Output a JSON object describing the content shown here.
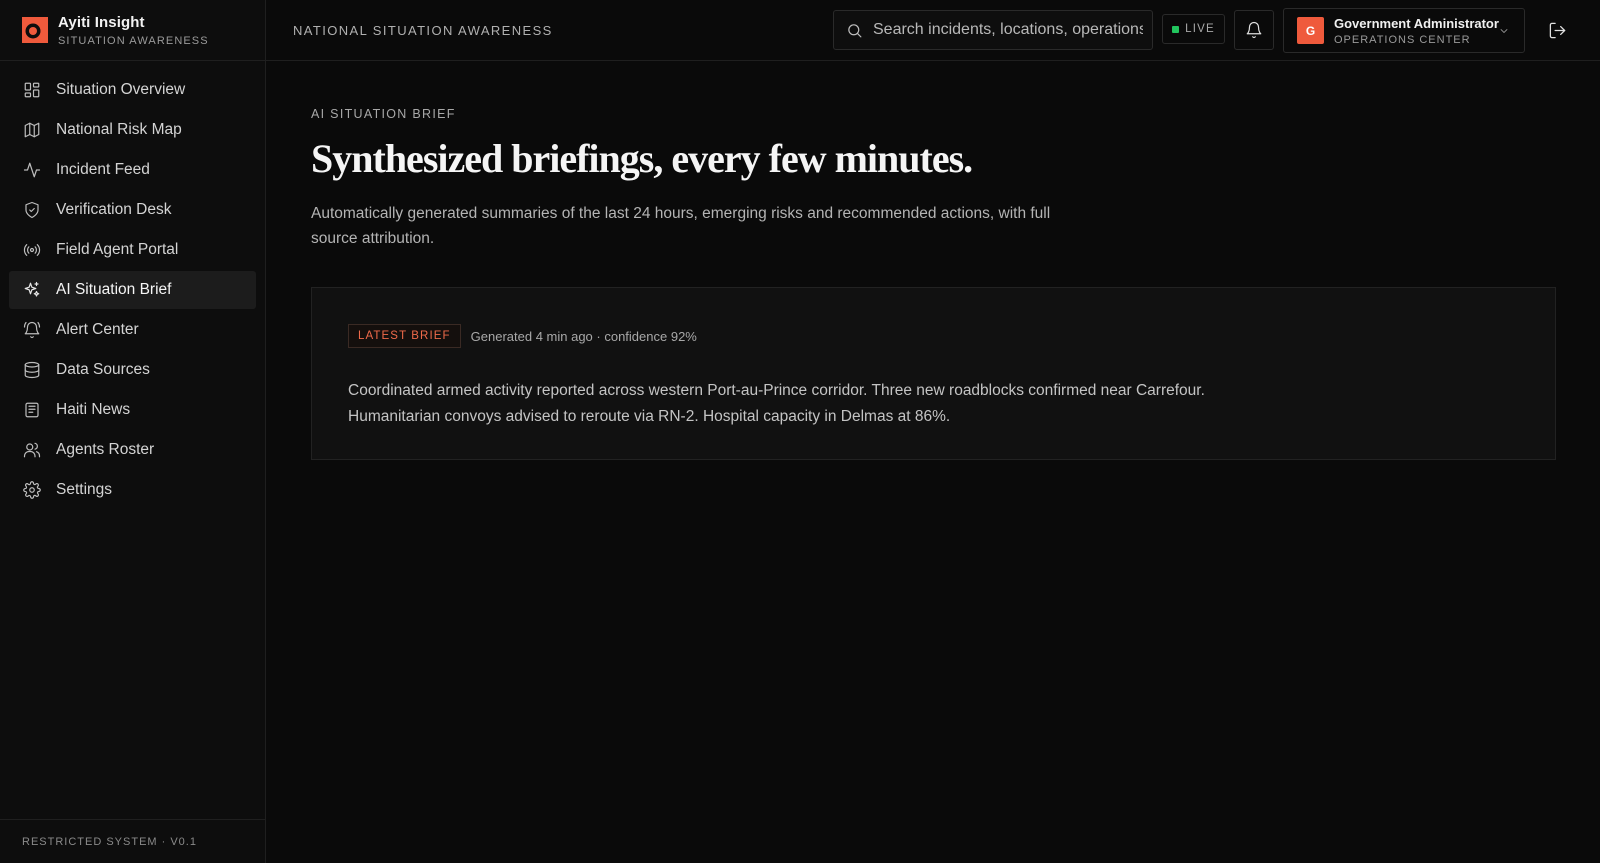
{
  "brand": {
    "name": "Ayiti Insight",
    "subtitle": "SITUATION AWARENESS",
    "accent": "#ef5a3c"
  },
  "sidebar": {
    "items": [
      {
        "label": "Situation Overview",
        "icon": "grid-icon"
      },
      {
        "label": "National Risk Map",
        "icon": "map-icon"
      },
      {
        "label": "Incident Feed",
        "icon": "activity-icon"
      },
      {
        "label": "Verification Desk",
        "icon": "shield-check-icon"
      },
      {
        "label": "Field Agent Portal",
        "icon": "radio-icon"
      },
      {
        "label": "AI Situation Brief",
        "icon": "sparkles-icon",
        "active": true
      },
      {
        "label": "Alert Center",
        "icon": "bell-ring-icon"
      },
      {
        "label": "Data Sources",
        "icon": "database-icon"
      },
      {
        "label": "Haiti News",
        "icon": "newspaper-icon"
      },
      {
        "label": "Agents Roster",
        "icon": "users-icon"
      },
      {
        "label": "Settings",
        "icon": "gear-icon"
      }
    ],
    "footer": "RESTRICTED SYSTEM · V0.1"
  },
  "topbar": {
    "title": "NATIONAL SITUATION AWARENESS",
    "search_placeholder": "Search incidents, locations, operations...",
    "live_label": "LIVE",
    "live_color": "#22c55e",
    "user": {
      "initial": "G",
      "name": "Government Administrator",
      "role": "OPERATIONS CENTER"
    }
  },
  "main": {
    "eyebrow": "AI SITUATION BRIEF",
    "headline": "Synthesized briefings, every few minutes.",
    "description": "Automatically generated summaries of the last 24 hours, emerging risks and recommended actions, with full source attribution.",
    "brief": {
      "badge": "LATEST BRIEF",
      "generated": "Generated 4 min ago · confidence 92%",
      "body": "Coordinated armed activity reported across western Port-au-Prince corridor. Three new roadblocks confirmed near Carrefour. Humanitarian convoys advised to reroute via RN-2. Hospital capacity in Delmas at 86%."
    }
  }
}
